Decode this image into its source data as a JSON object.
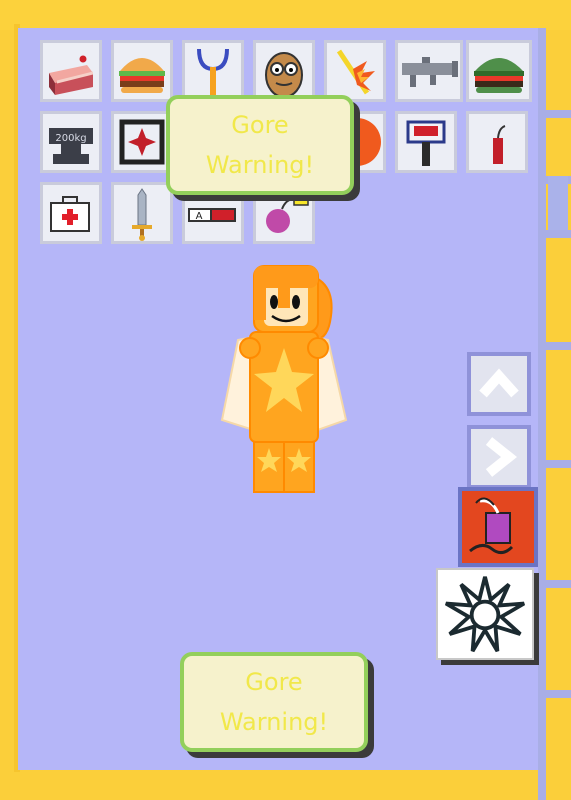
{
  "warnings": {
    "top": {
      "line1": "Gore",
      "line2": "Warning!"
    },
    "bottom": {
      "line1": "Gore",
      "line2": "Warning!"
    }
  },
  "inventory": {
    "row1": [
      "cake-icon",
      "burger-icon",
      "slingshot-icon",
      "potato-creature-icon",
      "fire-stick-icon",
      "rocket-launcher-icon",
      "green-burger-icon"
    ],
    "row2": [
      "anvil-200kg-icon",
      "spike-trap-icon",
      "",
      "orange-ball-icon",
      "tnt-hammer-icon",
      "dynamite-icon"
    ],
    "row3": [
      "medkit-icon",
      "sword-icon",
      "syringe-icon",
      "bomb-icon"
    ],
    "labels": {
      "anvil": "200kg",
      "syringe": "A"
    }
  },
  "colors": {
    "frame": "#fbcf3a",
    "panel": "#b5b6f8",
    "warning_bg": "#f6f2cc",
    "warning_border": "#93cf5b",
    "warning_text": "#f1e84a",
    "character": "#ffa51f"
  },
  "side_buttons": [
    "scroll-up-icon",
    "scroll-next-icon",
    "explosive-tool-icon",
    "explosion-burst-icon"
  ]
}
